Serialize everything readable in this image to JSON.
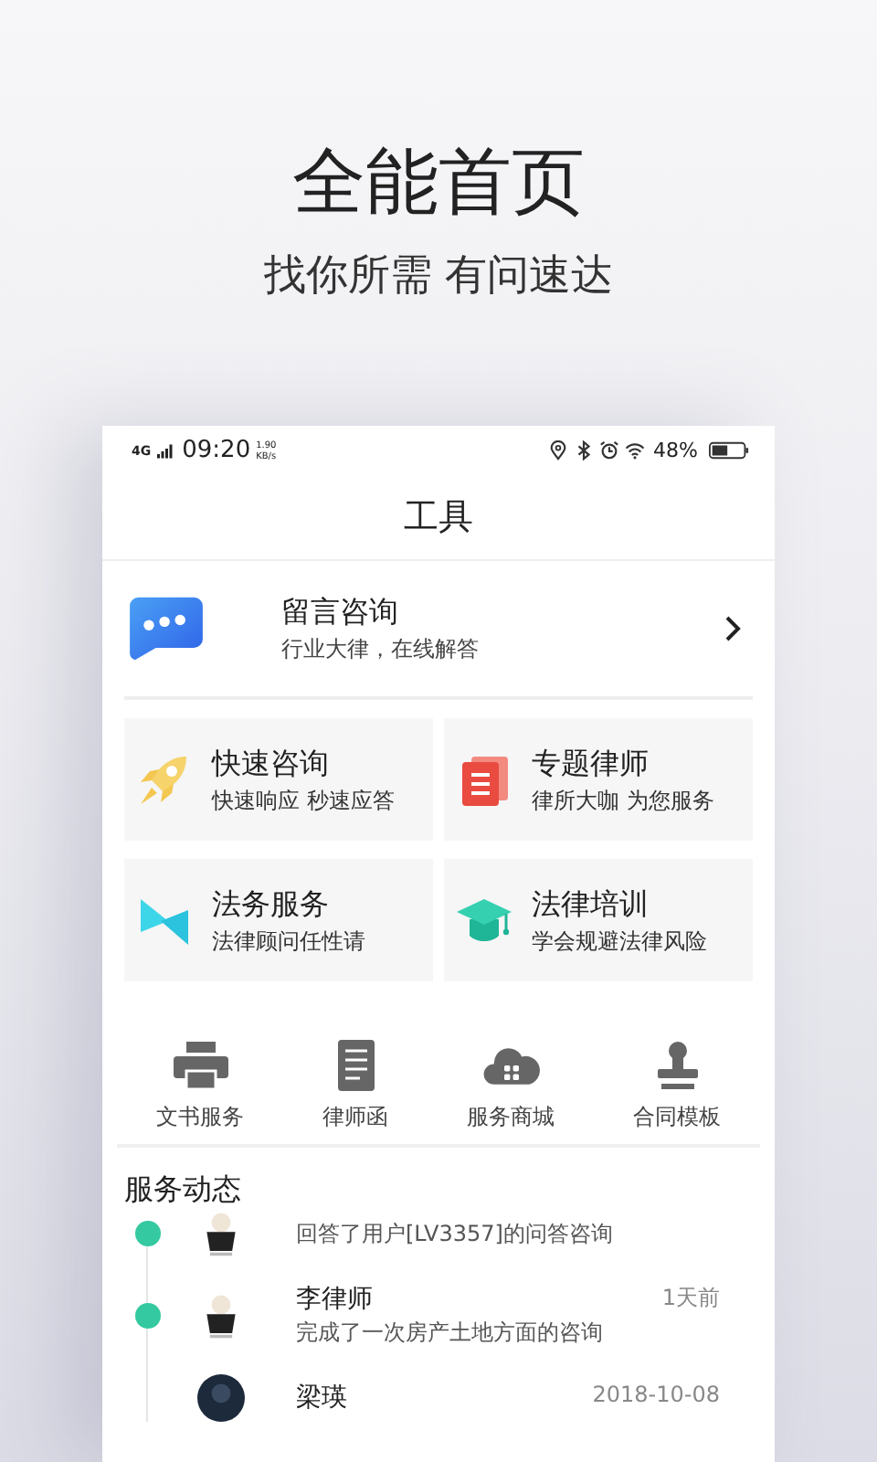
{
  "promo": {
    "title": "全能首页",
    "subtitle": "找你所需 有问速达"
  },
  "status_bar": {
    "network": "4G",
    "time": "09:20",
    "speed": "1.90",
    "speed_unit": "KB/s",
    "battery": "48%"
  },
  "header": {
    "title": "工具"
  },
  "consult": {
    "title": "留言咨询",
    "subtitle": "行业大律，在线解答"
  },
  "services": [
    {
      "kind": "rocket",
      "title": "快速咨询",
      "subtitle": "快速响应 秒速应答"
    },
    {
      "kind": "document",
      "title": "专题律师",
      "subtitle": "律所大咖 为您服务"
    },
    {
      "kind": "bowtie",
      "title": "法务服务",
      "subtitle": "法律顾问任性请"
    },
    {
      "kind": "cap",
      "title": "法律培训",
      "subtitle": "学会规避法律风险"
    }
  ],
  "tools": [
    {
      "kind": "printer",
      "label": "文书服务"
    },
    {
      "kind": "letter",
      "label": "律师函"
    },
    {
      "kind": "cloud",
      "label": "服务商城"
    },
    {
      "kind": "stamp",
      "label": "合同模板"
    }
  ],
  "feed": {
    "title": "服务动态",
    "items": [
      {
        "dot": true,
        "kind": "light",
        "text": "回答了用户[LV3357]的问答咨询"
      },
      {
        "dot": true,
        "kind": "light",
        "name": "李律师",
        "time": "1天前",
        "text": "完成了一次房产土地方面的咨询"
      },
      {
        "dot": false,
        "kind": "dark",
        "name": "梁瑛",
        "time": "2018-10-08"
      }
    ]
  }
}
